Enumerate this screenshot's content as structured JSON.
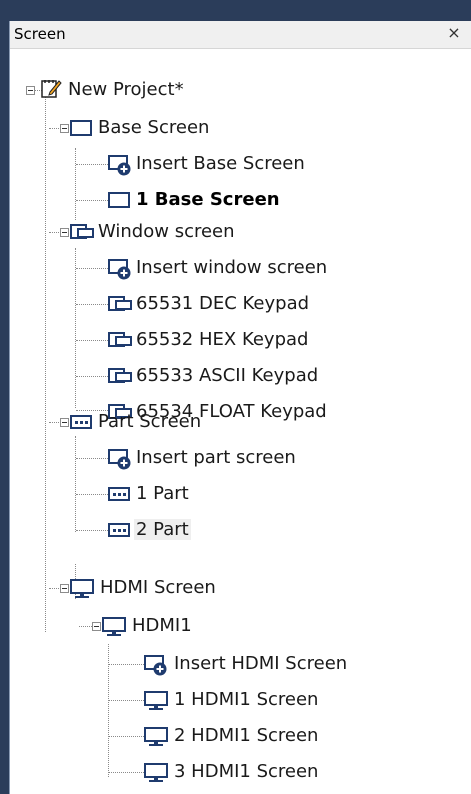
{
  "panel": {
    "title": "Screen",
    "close_glyph": "×"
  },
  "tree": {
    "root": {
      "label": "New Project*",
      "icon": "project-icon"
    },
    "base": {
      "label": "Base Screen",
      "items": [
        "Insert Base Screen",
        "1 Base Screen"
      ]
    },
    "window": {
      "label": "Window screen",
      "items": [
        "Insert window screen",
        "65531 DEC Keypad",
        "65532 HEX Keypad",
        "65533 ASCII Keypad",
        "65534 FLOAT Keypad"
      ]
    },
    "part": {
      "label": "Part Screen",
      "items": [
        "Insert part screen",
        "1 Part",
        "2 Part"
      ]
    },
    "hdmi": {
      "label": "HDMI Screen",
      "sub": {
        "label": "HDMI1",
        "items": [
          "Insert HDMI Screen",
          "1 HDMI1 Screen",
          "2 HDMI1 Screen",
          "3 HDMI1 Screen"
        ]
      }
    }
  }
}
